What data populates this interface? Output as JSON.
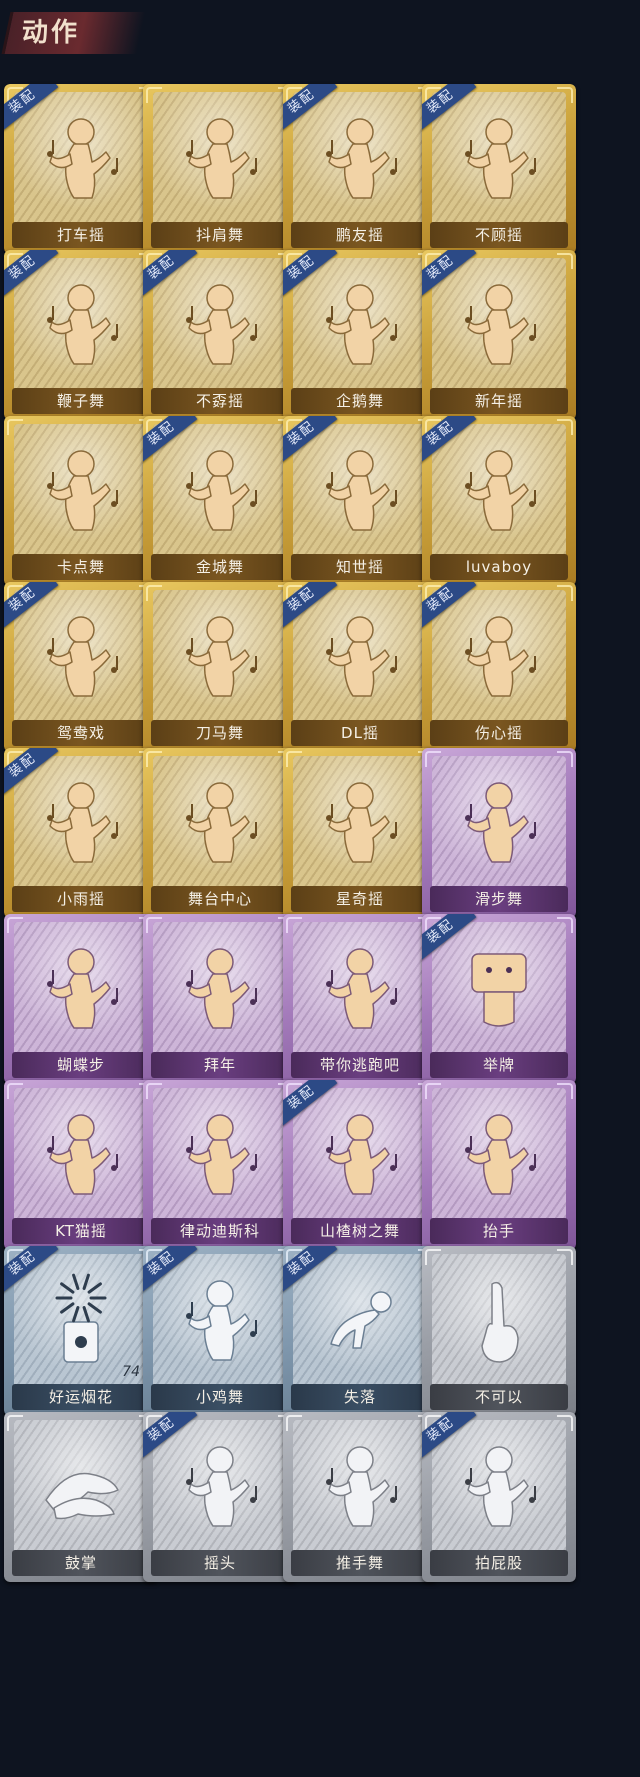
{
  "header": {
    "title": "动作"
  },
  "badge_text": "装配",
  "colors": {
    "gold": "#c9a03a",
    "purple": "#a47bbb",
    "blue": "#7f97ad",
    "white": "#9a9ea6",
    "badge": "#2c4a86",
    "background": "#0e1420"
  },
  "items": [
    {
      "label": "打车摇",
      "rarity": "gold",
      "equipped": true,
      "icon": "dance-figure-icon"
    },
    {
      "label": "抖肩舞",
      "rarity": "gold",
      "equipped": false,
      "icon": "dance-figure-icon"
    },
    {
      "label": "鹏友摇",
      "rarity": "gold",
      "equipped": true,
      "icon": "dance-figure-icon"
    },
    {
      "label": "不顾摇",
      "rarity": "gold",
      "equipped": true,
      "icon": "dance-figure-icon"
    },
    {
      "label": "鞭子舞",
      "rarity": "gold",
      "equipped": true,
      "icon": "dance-figure-icon"
    },
    {
      "label": "不孬摇",
      "rarity": "gold",
      "equipped": true,
      "icon": "dance-figure-icon"
    },
    {
      "label": "企鹅舞",
      "rarity": "gold",
      "equipped": true,
      "icon": "dance-figure-icon"
    },
    {
      "label": "新年摇",
      "rarity": "gold",
      "equipped": true,
      "icon": "dance-figure-icon"
    },
    {
      "label": "卡点舞",
      "rarity": "gold",
      "equipped": false,
      "icon": "dance-figure-icon"
    },
    {
      "label": "金城舞",
      "rarity": "gold",
      "equipped": true,
      "icon": "dance-figure-icon"
    },
    {
      "label": "知世摇",
      "rarity": "gold",
      "equipped": true,
      "icon": "dance-figure-icon"
    },
    {
      "label": "luvaboy",
      "rarity": "gold",
      "equipped": true,
      "icon": "dance-figure-icon"
    },
    {
      "label": "鸳鸯戏",
      "rarity": "gold",
      "equipped": true,
      "icon": "dance-figure-icon"
    },
    {
      "label": "刀马舞",
      "rarity": "gold",
      "equipped": false,
      "icon": "dance-figure-icon"
    },
    {
      "label": "DL摇",
      "rarity": "gold",
      "equipped": true,
      "icon": "dance-figure-icon"
    },
    {
      "label": "伤心摇",
      "rarity": "gold",
      "equipped": true,
      "icon": "heart-hands-figure-icon"
    },
    {
      "label": "小雨摇",
      "rarity": "gold",
      "equipped": true,
      "icon": "dance-figure-icon"
    },
    {
      "label": "舞台中心",
      "rarity": "gold",
      "equipped": false,
      "icon": "dance-figure-icon"
    },
    {
      "label": "星奇摇",
      "rarity": "gold",
      "equipped": false,
      "icon": "dance-figure-icon"
    },
    {
      "label": "滑步舞",
      "rarity": "purple",
      "equipped": false,
      "icon": "dance-figure-icon"
    },
    {
      "label": "蝴蝶步",
      "rarity": "purple",
      "equipped": false,
      "icon": "dance-figure-icon"
    },
    {
      "label": "拜年",
      "rarity": "purple",
      "equipped": false,
      "icon": "bow-figure-icon"
    },
    {
      "label": "带你逃跑吧",
      "rarity": "purple",
      "equipped": false,
      "icon": "dance-figure-icon"
    },
    {
      "label": "举牌",
      "rarity": "purple",
      "equipped": true,
      "icon": "sign-holding-figure-icon"
    },
    {
      "label": "KT猫摇",
      "rarity": "purple",
      "equipped": false,
      "icon": "dance-figure-icon"
    },
    {
      "label": "律动迪斯科",
      "rarity": "purple",
      "equipped": false,
      "icon": "dance-figure-icon"
    },
    {
      "label": "山楂树之舞",
      "rarity": "purple",
      "equipped": true,
      "icon": "dance-figure-icon"
    },
    {
      "label": "抬手",
      "rarity": "purple",
      "equipped": false,
      "icon": "raise-hand-figure-icon"
    },
    {
      "label": "好运烟花",
      "rarity": "blue",
      "equipped": true,
      "icon": "firework-icon",
      "count": "74"
    },
    {
      "label": "小鸡舞",
      "rarity": "blue",
      "equipped": true,
      "icon": "chicken-dance-figure-icon"
    },
    {
      "label": "失落",
      "rarity": "blue",
      "equipped": true,
      "icon": "crawling-figure-icon"
    },
    {
      "label": "不可以",
      "rarity": "white",
      "equipped": false,
      "icon": "pointing-finger-icon"
    },
    {
      "label": "鼓掌",
      "rarity": "white",
      "equipped": false,
      "icon": "clapping-hands-icon"
    },
    {
      "label": "摇头",
      "rarity": "white",
      "equipped": true,
      "icon": "head-shake-figure-icon"
    },
    {
      "label": "推手舞",
      "rarity": "white",
      "equipped": false,
      "icon": "push-hands-figure-icon"
    },
    {
      "label": "拍屁股",
      "rarity": "white",
      "equipped": true,
      "icon": "butt-slap-figure-icon"
    }
  ]
}
